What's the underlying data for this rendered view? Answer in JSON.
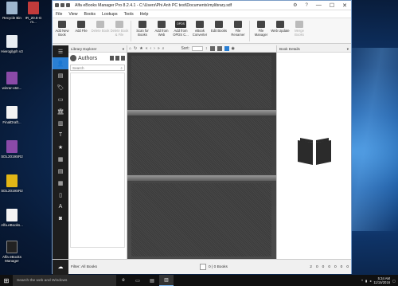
{
  "desktop": {
    "icons": [
      {
        "label": "Recycle Bin",
        "color": "#9fb7cf"
      },
      {
        "label": "IR_20.8-Gm...",
        "color": "#c23b3b"
      },
      {
        "label": "Hieroglyph v3",
        "color": "#e9eef3"
      },
      {
        "label": "winrar-x64...",
        "color": "#8a4aa8"
      },
      {
        "label": "FinalDraft...",
        "color": "#f4f4f4"
      },
      {
        "label": "SDL2019SR2",
        "color": "#8a4aa8"
      },
      {
        "label": "SDL2019SR2",
        "color": "#e2b616"
      },
      {
        "label": "Alfa.eBooks...",
        "color": "#f4f4f4"
      },
      {
        "label": "Alfa eBooks Manager",
        "color": "#222222"
      }
    ]
  },
  "window": {
    "title": "Alfa eBooks Manager Pro 8.2.4.1 - C:\\Users\\Phi Anh PC test\\Documents\\mylibrary.sdf",
    "controls": {
      "minimize": "—",
      "maximize": "☐",
      "close": "✕",
      "help": "?",
      "settings": "⚙"
    },
    "menu": [
      "File",
      "View",
      "Books",
      "Lookups",
      "Tools",
      "Help"
    ],
    "ribbon": [
      {
        "label": "Add New Book",
        "disabled": false,
        "icon": "book-add-icon"
      },
      {
        "label": "Add File",
        "disabled": false,
        "icon": "file-add-icon"
      },
      {
        "label": "Delete Book",
        "disabled": true,
        "icon": "delete-icon"
      },
      {
        "label": "Delete Book & File",
        "disabled": true,
        "icon": "delete-file-icon"
      },
      {
        "label": "Scan for Books",
        "disabled": false,
        "icon": "scan-icon"
      },
      {
        "label": "Add from Web",
        "disabled": false,
        "icon": "web-icon"
      },
      {
        "label": "Add from OPDS C...",
        "disabled": false,
        "icon": "opds-icon",
        "badge": "OPDS"
      },
      {
        "label": "eBook Converter",
        "disabled": false,
        "icon": "convert-icon"
      },
      {
        "label": "Edit Books",
        "disabled": false,
        "icon": "edit-icon"
      },
      {
        "label": "File Renamer",
        "disabled": false,
        "icon": "rename-icon"
      },
      {
        "label": "File Manager",
        "disabled": false,
        "icon": "folder-icon"
      },
      {
        "label": "Web Update",
        "disabled": false,
        "icon": "web-update-icon"
      },
      {
        "label": "Merge Books",
        "disabled": true,
        "icon": "merge-icon"
      }
    ],
    "library_explorer": {
      "title": "Library Explorer",
      "section": "Authors",
      "search_placeholder": "Search"
    },
    "toolbar": {
      "sort_label": "Sort:"
    },
    "book_details": {
      "title": "Book Details"
    },
    "status": {
      "filter": "Filter:  All Books",
      "count": "0 | 0 Books",
      "stats": [
        "2",
        "0",
        "0",
        "0",
        "0",
        "0",
        "0"
      ]
    }
  },
  "taskbar": {
    "search_text": "Search the web and Windows",
    "time": "5:34 AM",
    "date": "11/15/2016"
  }
}
